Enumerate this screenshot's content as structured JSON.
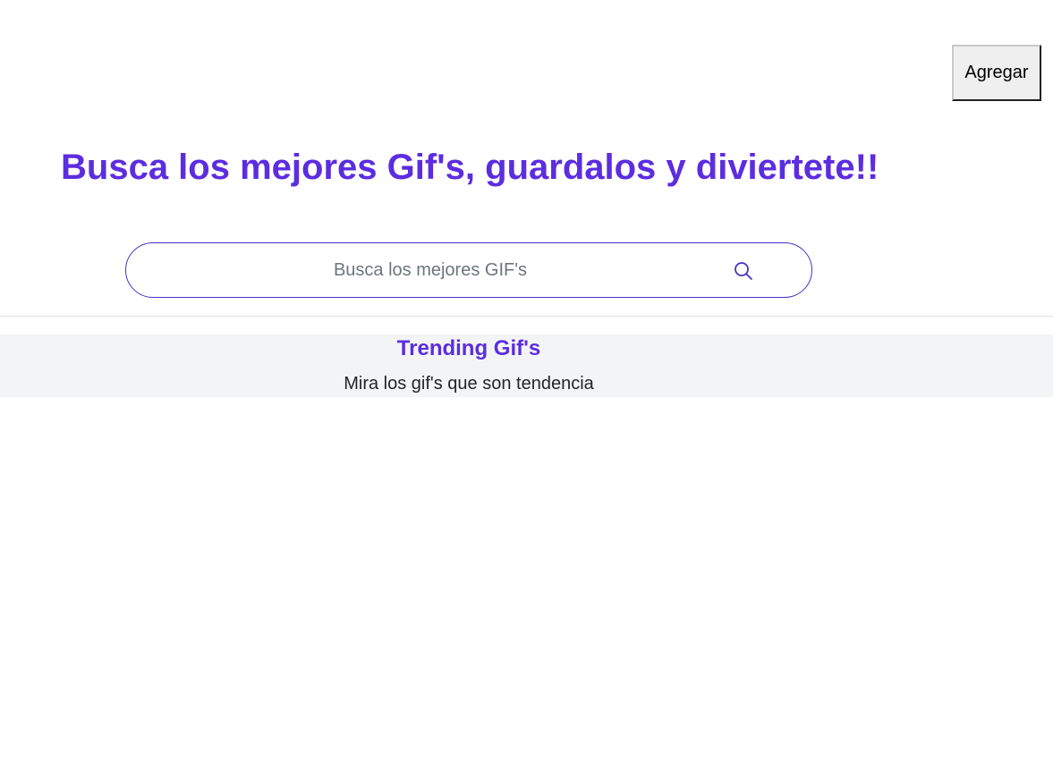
{
  "header": {
    "add_button_label": "Agregar"
  },
  "hero": {
    "title": "Busca los mejores Gif's, guardalos y diviertete!!"
  },
  "search": {
    "placeholder": "Busca los mejores GIF's",
    "value": "",
    "icon": "search-icon"
  },
  "trending": {
    "title": "Trending Gif's",
    "subtitle": "Mira los gif's que son tendencia"
  },
  "colors": {
    "accent": "#5c2de0",
    "search_border": "#4a2fc7",
    "trending_background": "#f3f4f6"
  }
}
